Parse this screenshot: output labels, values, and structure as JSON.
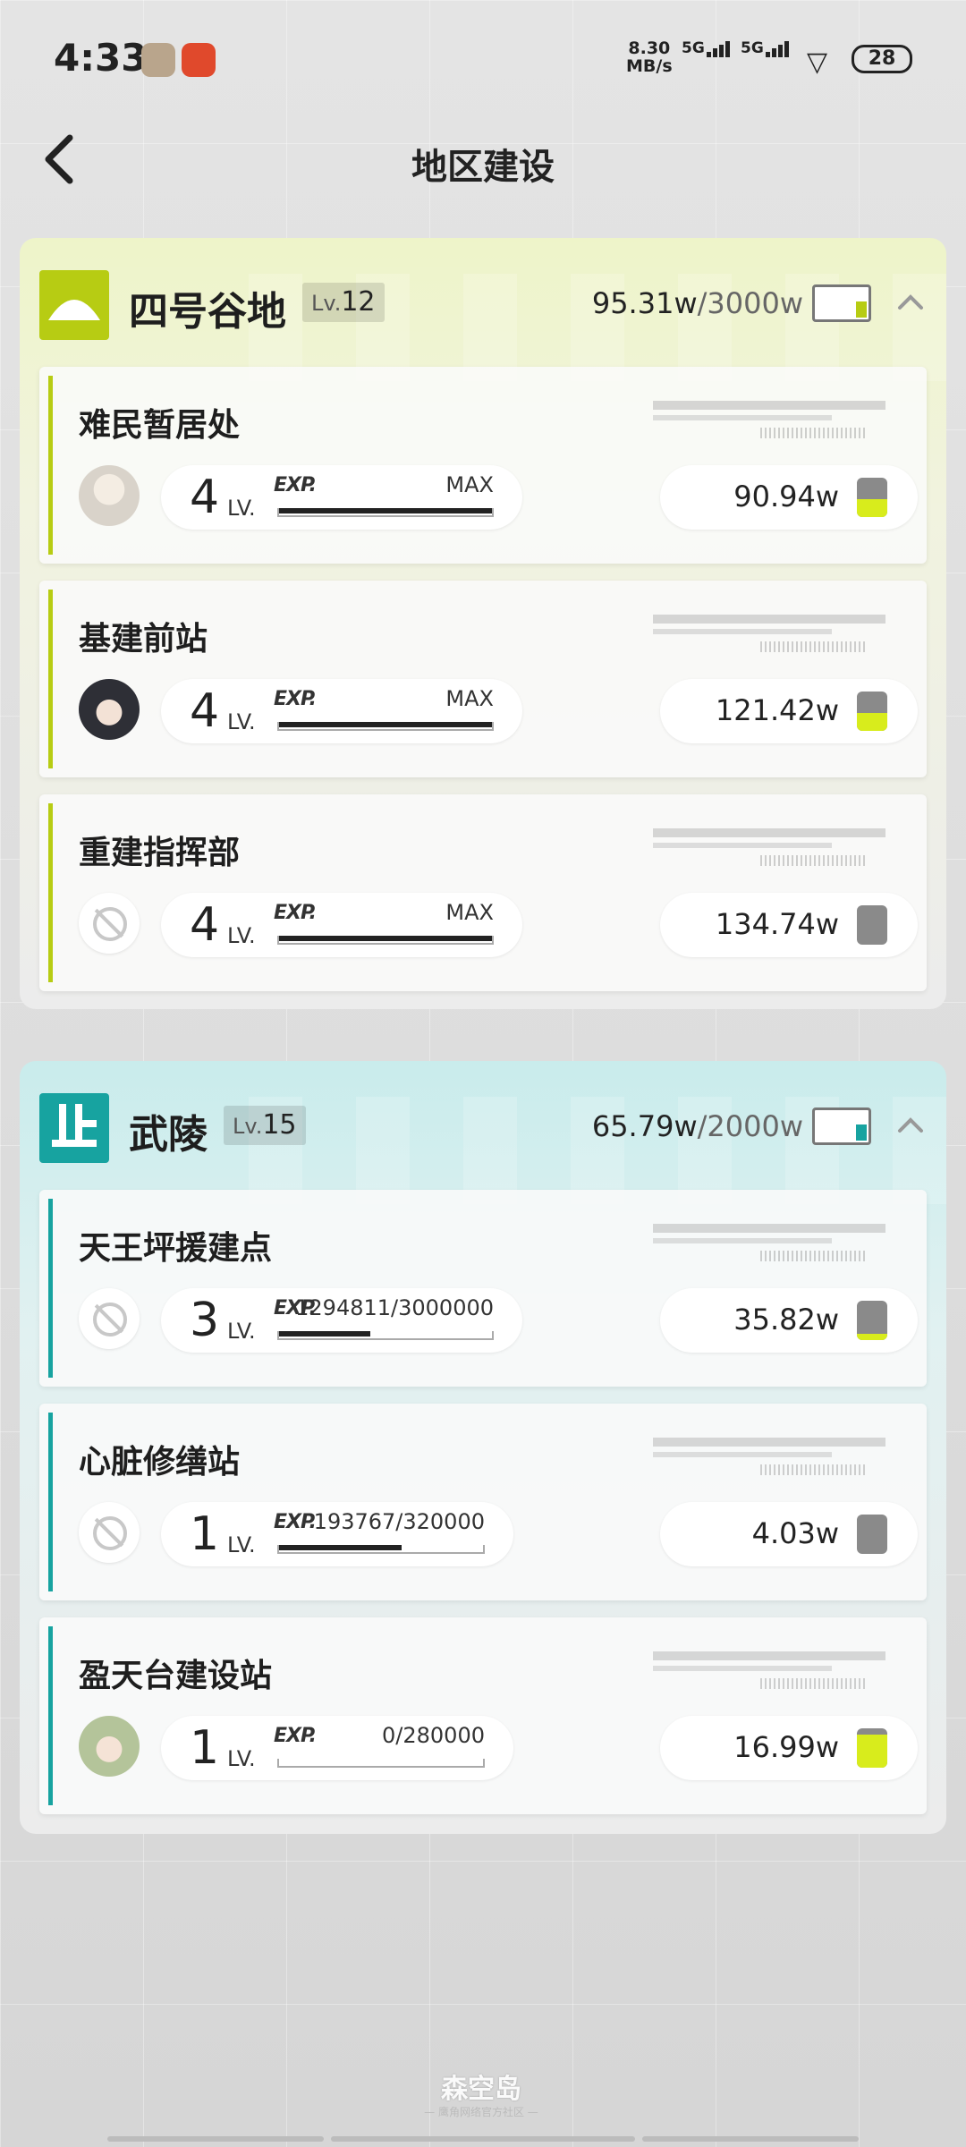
{
  "status_bar": {
    "time": "4:33",
    "net_speed_value": "8.30",
    "net_speed_unit": "MB/s",
    "signal1": "5G",
    "signal2": "5G",
    "battery": "28"
  },
  "header": {
    "title": "地区建设"
  },
  "regions": [
    {
      "name": "四号谷地",
      "lv_prefix": "Lv.",
      "lv": "12",
      "current": "95.31w",
      "total": "/3000w",
      "buildings": [
        {
          "name": "难民暂居处",
          "level": "4",
          "lv_label": "LV.",
          "exp_tag": "EXP.",
          "exp_value": "MAX",
          "exp_fraction": 1.0,
          "resource": "90.94w",
          "resource_fill": 0.45,
          "avatar": "character-avatar"
        },
        {
          "name": "基建前站",
          "level": "4",
          "lv_label": "LV.",
          "exp_tag": "EXP.",
          "exp_value": "MAX",
          "exp_fraction": 1.0,
          "resource": "121.42w",
          "resource_fill": 0.45,
          "avatar": "character-avatar"
        },
        {
          "name": "重建指挥部",
          "level": "4",
          "lv_label": "LV.",
          "exp_tag": "EXP.",
          "exp_value": "MAX",
          "exp_fraction": 1.0,
          "resource": "134.74w",
          "resource_fill": 0.0,
          "avatar": "empty-slot-icon"
        }
      ]
    },
    {
      "name": "武陵",
      "lv_prefix": "Lv.",
      "lv": "15",
      "current": "65.79w",
      "total": "/2000w",
      "buildings": [
        {
          "name": "天王坪援建点",
          "level": "3",
          "lv_label": "LV.",
          "exp_tag": "EXP.",
          "exp_value": "1294811/3000000",
          "exp_fraction": 0.43,
          "resource": "35.82w",
          "resource_fill": 0.15,
          "avatar": "empty-slot-icon"
        },
        {
          "name": "心脏修缮站",
          "level": "1",
          "lv_label": "LV.",
          "exp_tag": "EXP.",
          "exp_value": "193767/320000",
          "exp_fraction": 0.6,
          "resource": "4.03w",
          "resource_fill": 0.0,
          "avatar": "empty-slot-icon"
        },
        {
          "name": "盈天台建设站",
          "level": "1",
          "lv_label": "LV.",
          "exp_tag": "EXP.",
          "exp_value": "0/280000",
          "exp_fraction": 0.0,
          "resource": "16.99w",
          "resource_fill": 0.85,
          "avatar": "character-avatar"
        }
      ]
    }
  ],
  "footer": {
    "logo": "森空岛",
    "sub": "— 鹰角网络官方社区 —"
  },
  "colors": {
    "region1_accent": "#b7cc13",
    "region2_accent": "#17a3a0",
    "resource_fill": "#d8ec1c"
  }
}
